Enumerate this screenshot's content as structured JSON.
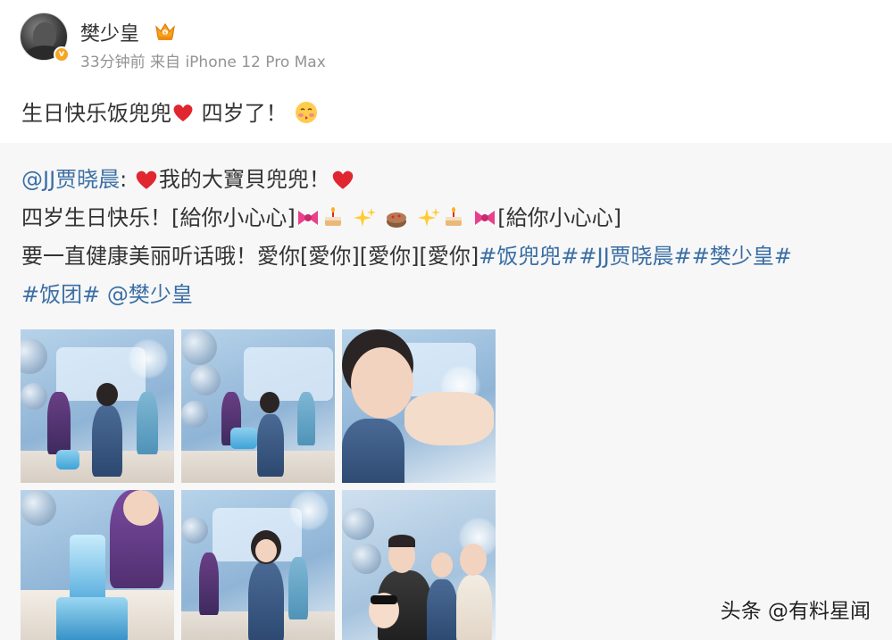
{
  "post": {
    "username": "樊少皇",
    "meta": "33分钟前 来自 iPhone 12 Pro Max",
    "text_before": "生日快乐饭兜兜",
    "text_after": " 四岁了！"
  },
  "repost": {
    "author_mention": "@JJ贾晓晨",
    "line1_sep": ": ",
    "line1_text": "我的大寶貝兜兜！",
    "line2_a": "四岁生日快乐！[給你小心心]",
    "line2_b": "[給你小心心]",
    "line3_text": "要一直健康美丽听话哦！愛你[愛你][愛你][愛你]",
    "hashtag1": "#饭兜兜#",
    "hashtag2": "#JJ贾晓晨#",
    "hashtag3": "#樊少皇#",
    "hashtag4": "#饭团#",
    "mention_end": "@樊少皇"
  },
  "photos": [
    {
      "name": "photo-1"
    },
    {
      "name": "photo-2"
    },
    {
      "name": "photo-3"
    },
    {
      "name": "photo-4"
    },
    {
      "name": "photo-5"
    },
    {
      "name": "photo-6"
    }
  ],
  "icons": {
    "verified": "verified-badge-icon",
    "crown": "crown-badge-icon",
    "heart": "red-heart-icon",
    "blush": "blush-face-icon",
    "ribbon": "ribbon-icon",
    "cake": "birthday-cake-icon",
    "sparkles": "sparkles-icon"
  },
  "watermark": "头条 @有料星闻",
  "colors": {
    "link": "#3b6fa5",
    "meta_text": "#939393",
    "repost_bg": "#f7f7f7",
    "verified": "#f5a623",
    "heart": "#e0262e"
  }
}
